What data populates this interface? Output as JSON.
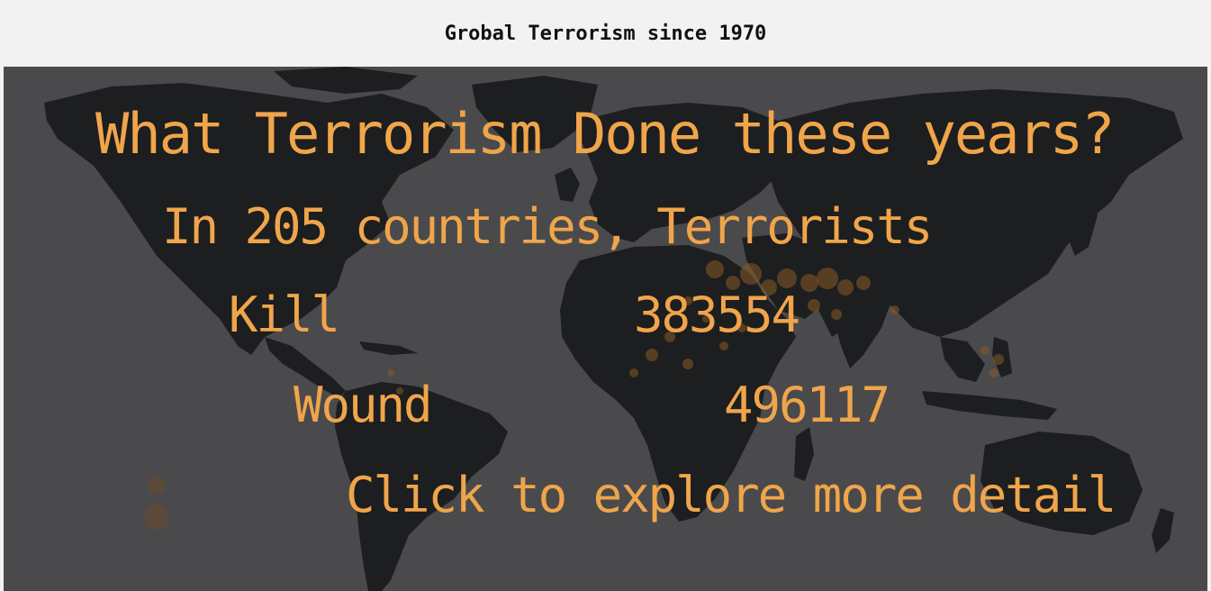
{
  "header": {
    "title": "Grobal Terrorism since 1970"
  },
  "hero": {
    "question": "What Terrorism Done these years?",
    "countries_line": "In 205 countries, Terrorists",
    "kill_label": "Kill",
    "kill_value": "383554",
    "wound_label": "Wound",
    "wound_value": "496117",
    "cta": "Click to explore more detail"
  },
  "colors": {
    "accent": "#f0a54a",
    "ocean": "#4a4a4c",
    "land": "#1c1e20",
    "header_bg": "#f2f2f2"
  }
}
